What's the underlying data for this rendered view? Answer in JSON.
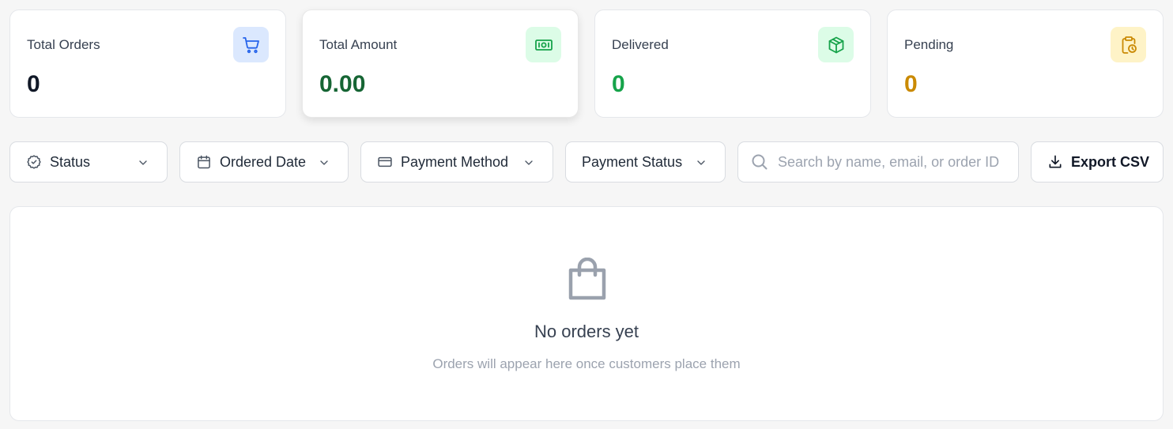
{
  "stats": [
    {
      "label": "Total Orders",
      "value": "0",
      "icon": "cart-icon",
      "icon_bg": "#dbe8fe",
      "icon_color": "#2563eb",
      "value_color": "#111827"
    },
    {
      "label": "Total Amount",
      "value": "0.00",
      "icon": "banknote-icon",
      "icon_bg": "#dcfce7",
      "icon_color": "#16a34a",
      "value_color": "#166534"
    },
    {
      "label": "Delivered",
      "value": "0",
      "icon": "package-icon",
      "icon_bg": "#dcfce7",
      "icon_color": "#16a34a",
      "value_color": "#16a34a"
    },
    {
      "label": "Pending",
      "value": "0",
      "icon": "clipboard-clock-icon",
      "icon_bg": "#fef3c7",
      "icon_color": "#ca8a04",
      "value_color": "#ca8a04"
    }
  ],
  "filters": {
    "status": "Status",
    "ordered_date": "Ordered Date",
    "payment_method": "Payment Method",
    "payment_status": "Payment Status"
  },
  "search": {
    "placeholder": "Search by name, email, or order ID",
    "value": ""
  },
  "export_label": "Export CSV",
  "empty": {
    "title": "No orders yet",
    "subtitle": "Orders will appear here once customers place them",
    "icon": "shopping-bag-icon"
  }
}
